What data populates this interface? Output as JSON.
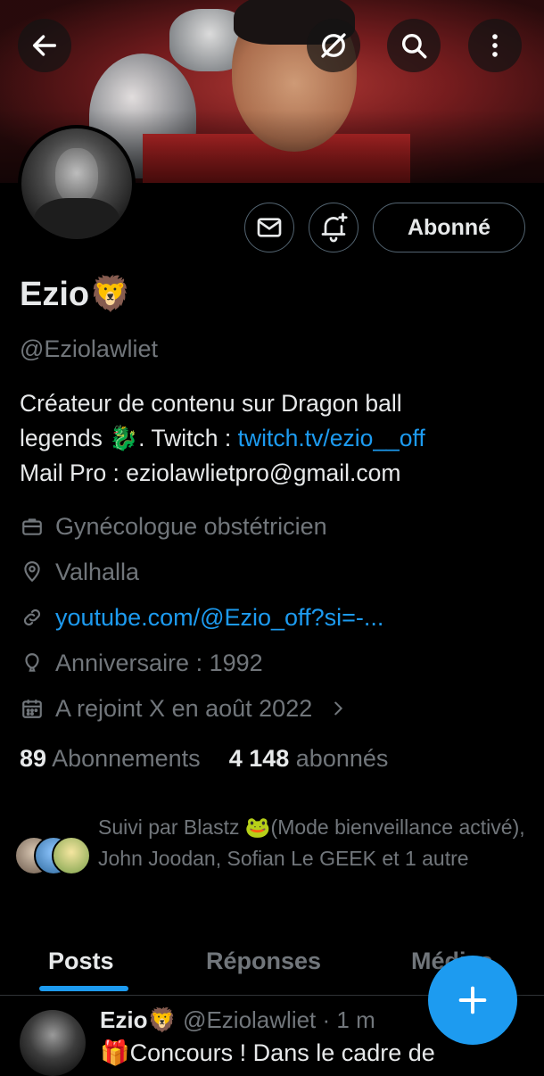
{
  "header": {
    "back_icon": "arrow-left-icon",
    "grok_icon": "grok-icon",
    "search_icon": "search-icon",
    "more_icon": "more-vertical-icon"
  },
  "profile": {
    "name": "Ezio",
    "name_emoji": "🦁",
    "handle": "@Eziolawliet",
    "bio_line1": "Créateur de contenu sur Dragon ball",
    "bio_line2_prefix": "legends 🐉.  Twitch : ",
    "bio_link": "twitch.tv/ezio__off",
    "bio_line3": "Mail Pro : eziolawlietpro@gmail.com",
    "profession": "Gynécologue obstétricien",
    "location": "Valhalla",
    "website": "youtube.com/@Ezio_off?si=-...",
    "birthday": "Anniversaire : 1992",
    "joined": "A rejoint X en août 2022",
    "following_count": "89",
    "following_label": "Abonnements",
    "followers_count": "4 148",
    "followers_label": "abonnés",
    "followed_by": "Suivi par Blastz 🐸(Mode bienveillance activé), John Joodan, Sofian Le GEEK et 1 autre"
  },
  "actions": {
    "follow_label": "Abonné",
    "message_icon": "mail-icon",
    "notify_icon": "bell-plus-icon"
  },
  "tabs": [
    {
      "label": "Posts"
    },
    {
      "label": "Réponses"
    },
    {
      "label": "Médias"
    }
  ],
  "post": {
    "author": "Ezio🦁",
    "handle": "@Eziolawliet",
    "time": "· 1 m",
    "text": "🎁Concours ! Dans le cadre de"
  },
  "colors": {
    "accent": "#1d9bf0",
    "background": "#000000",
    "text": "#e7e9ea",
    "muted": "#71767b"
  }
}
